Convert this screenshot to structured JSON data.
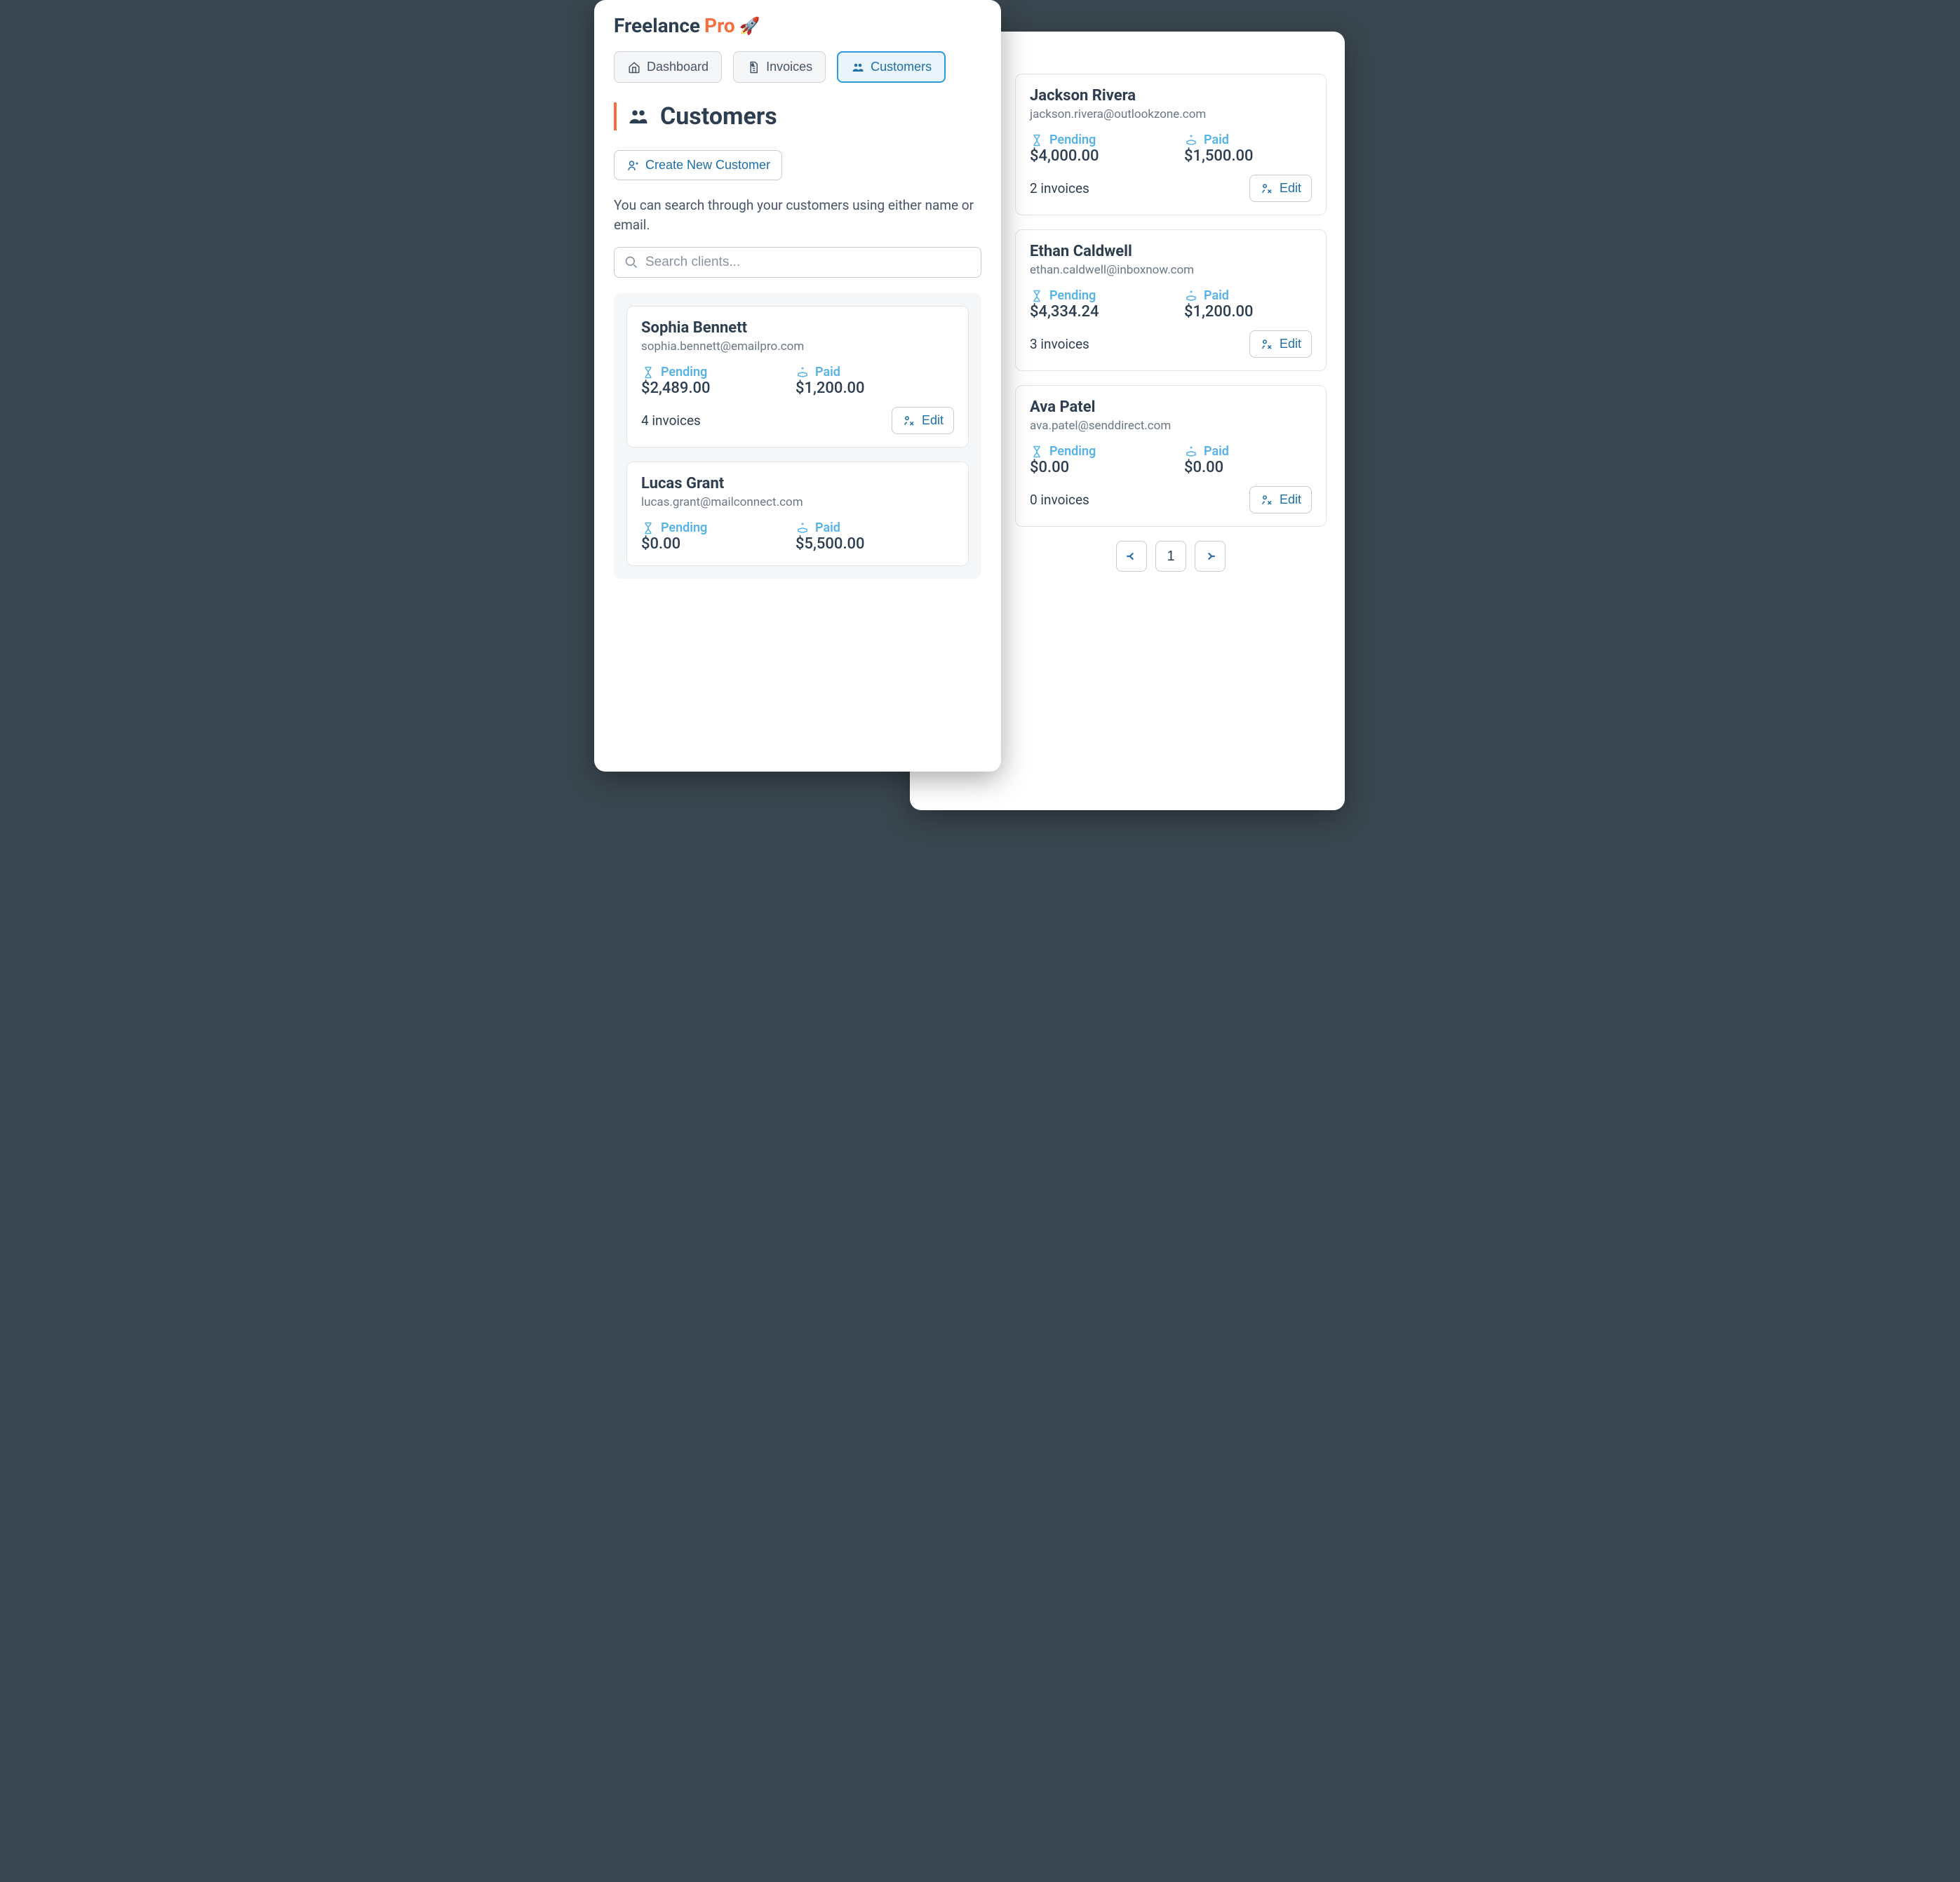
{
  "brand": {
    "name": "Freelance",
    "suffix": "Pro"
  },
  "tabs": {
    "dashboard": "Dashboard",
    "invoices": "Invoices",
    "customers": "Customers"
  },
  "section": {
    "title": "Customers"
  },
  "actions": {
    "create": "Create New Customer"
  },
  "helper": "You can search through your customers using either name or email.",
  "search": {
    "placeholder": "Search clients..."
  },
  "labels": {
    "pending": "Pending",
    "paid": "Paid",
    "edit": "Edit"
  },
  "pager": {
    "page": "1"
  },
  "customers_left": [
    {
      "name": "Sophia Bennett",
      "email": "sophia.bennett@emailpro.com",
      "pending": "$2,489.00",
      "paid": "$1,200.00",
      "invoices": "4 invoices"
    },
    {
      "name": "Lucas Grant",
      "email": "lucas.grant@mailconnect.com",
      "pending": "$0.00",
      "paid": "$5,500.00",
      "invoices": ""
    }
  ],
  "customers_right": [
    {
      "name": "Jackson Rivera",
      "email": "jackson.rivera@outlookzone.com",
      "pending": "$4,000.00",
      "paid": "$1,500.00",
      "invoices": "2 invoices"
    },
    {
      "name": "Ethan Caldwell",
      "email": "ethan.caldwell@inboxnow.com",
      "pending": "$4,334.24",
      "paid": "$1,200.00",
      "invoices": "3 invoices"
    },
    {
      "name": "Ava Patel",
      "email": "ava.patel@senddirect.com",
      "pending": "$0.00",
      "paid": "$0.00",
      "invoices": "0 invoices"
    }
  ]
}
